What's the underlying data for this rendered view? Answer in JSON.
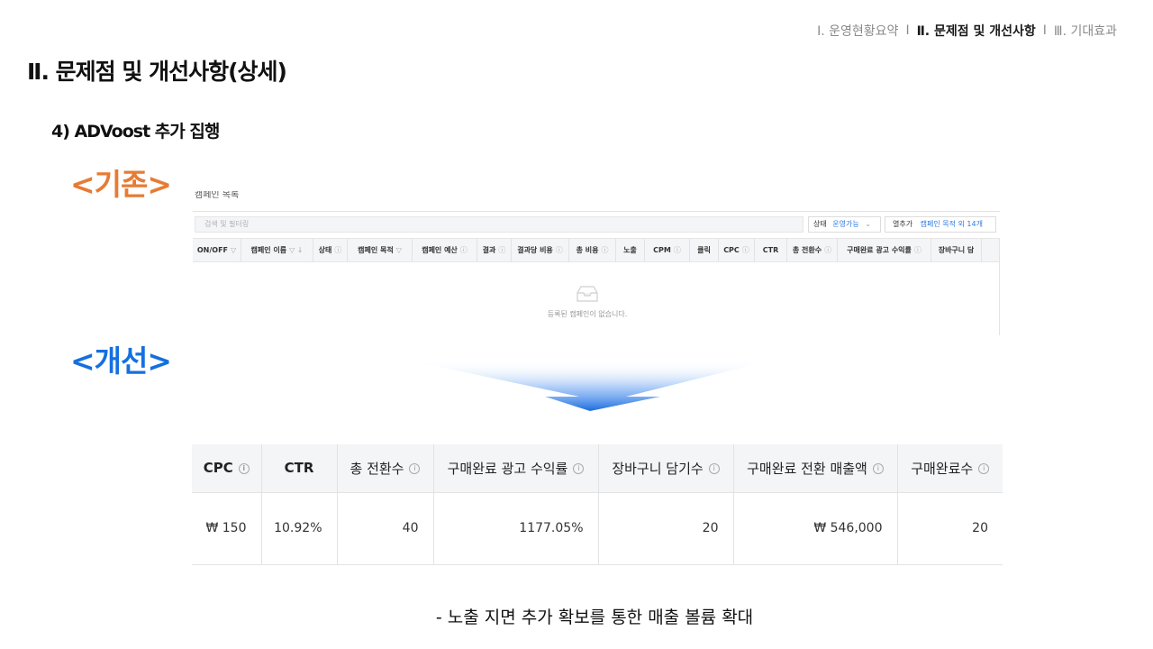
{
  "nav": {
    "items": [
      {
        "label": "Ⅰ. 운영현황요약",
        "active": false
      },
      {
        "label": "Ⅱ. 문제점 및 개선사항",
        "active": true
      },
      {
        "label": "Ⅲ. 기대효과",
        "active": false
      }
    ],
    "separator": "I"
  },
  "page_title": "Ⅱ. 문제점 및 개선사항(상세)",
  "sub_title": "4) ADVoost 추가 집행",
  "before_label": "<기존>",
  "after_label": "<개선>",
  "before": {
    "search_placeholder": "검색 및 필터링",
    "status_label": "상태",
    "status_value": "운영가능",
    "columns_label": "열추가",
    "columns_value": "캠페인 목적 외 14개",
    "headers": [
      {
        "label": "ON/OFF",
        "icon": "▽"
      },
      {
        "label": "캠페인 이름",
        "icon": "▽ ↓"
      },
      {
        "label": "상태",
        "icon": "ⓘ"
      },
      {
        "label": "캠페인 목적",
        "icon": "▽"
      },
      {
        "label": "캠페인 예산",
        "icon": "ⓘ"
      },
      {
        "label": "결과",
        "icon": "ⓘ"
      },
      {
        "label": "결과당 비용",
        "icon": "ⓘ"
      },
      {
        "label": "총 비용",
        "icon": "ⓘ"
      },
      {
        "label": "노출",
        "icon": ""
      },
      {
        "label": "CPM",
        "icon": "ⓘ"
      },
      {
        "label": "클릭",
        "icon": ""
      },
      {
        "label": "CPC",
        "icon": "ⓘ"
      },
      {
        "label": "CTR",
        "icon": ""
      },
      {
        "label": "총 전환수",
        "icon": "ⓘ"
      },
      {
        "label": "구매완료 광고 수익률",
        "icon": "ⓘ"
      },
      {
        "label": "장바구니 담",
        "icon": ""
      }
    ],
    "empty_message": "등록된 캠페인이 없습니다."
  },
  "after": {
    "headers": [
      {
        "label": "CPC",
        "bold": true,
        "info": true
      },
      {
        "label": "CTR",
        "bold": true,
        "info": false
      },
      {
        "label": "총 전환수",
        "bold": false,
        "info": true
      },
      {
        "label": "구매완료 광고 수익률",
        "bold": false,
        "info": true
      },
      {
        "label": "장바구니 담기수",
        "bold": false,
        "info": true
      },
      {
        "label": "구매완료 전환 매출액",
        "bold": false,
        "info": true
      },
      {
        "label": "구매완료수",
        "bold": false,
        "info": true
      }
    ],
    "row": [
      "₩ 150",
      "10.92%",
      "40",
      "1177.05%",
      "20",
      "₩ 546,000",
      "20"
    ]
  },
  "footnote": "- 노출 지면 추가 확보를 통한 매출 볼륨 확대",
  "colors": {
    "before_accent": "#e77b33",
    "after_accent": "#1470e0",
    "arrow": "#1a6de0"
  }
}
